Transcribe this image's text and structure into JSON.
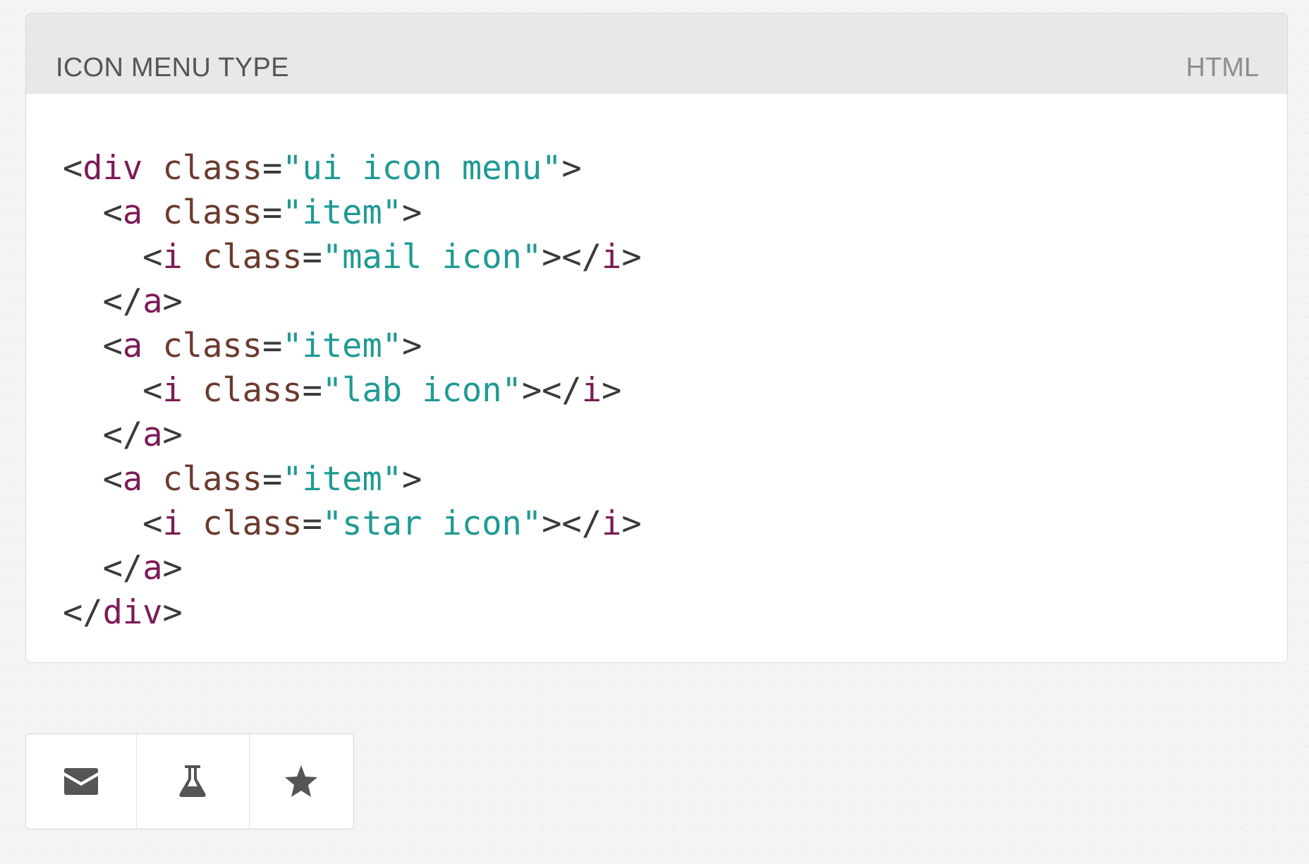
{
  "panel": {
    "title": "ICON MENU TYPE",
    "language": "HTML"
  },
  "code": {
    "lines": [
      [
        {
          "t": "punct",
          "v": "<"
        },
        {
          "t": "tag",
          "v": "div"
        },
        {
          "t": "punct",
          "v": " "
        },
        {
          "t": "attr",
          "v": "class"
        },
        {
          "t": "punct",
          "v": "="
        },
        {
          "t": "val",
          "v": "\"ui icon menu\""
        },
        {
          "t": "punct",
          "v": ">"
        }
      ],
      [
        {
          "t": "punct",
          "v": "  <"
        },
        {
          "t": "tag",
          "v": "a"
        },
        {
          "t": "punct",
          "v": " "
        },
        {
          "t": "attr",
          "v": "class"
        },
        {
          "t": "punct",
          "v": "="
        },
        {
          "t": "val",
          "v": "\"item\""
        },
        {
          "t": "punct",
          "v": ">"
        }
      ],
      [
        {
          "t": "punct",
          "v": "    <"
        },
        {
          "t": "tag",
          "v": "i"
        },
        {
          "t": "punct",
          "v": " "
        },
        {
          "t": "attr",
          "v": "class"
        },
        {
          "t": "punct",
          "v": "="
        },
        {
          "t": "val",
          "v": "\"mail icon\""
        },
        {
          "t": "punct",
          "v": "></"
        },
        {
          "t": "tag",
          "v": "i"
        },
        {
          "t": "punct",
          "v": ">"
        }
      ],
      [
        {
          "t": "punct",
          "v": "  </"
        },
        {
          "t": "tag",
          "v": "a"
        },
        {
          "t": "punct",
          "v": ">"
        }
      ],
      [
        {
          "t": "punct",
          "v": "  <"
        },
        {
          "t": "tag",
          "v": "a"
        },
        {
          "t": "punct",
          "v": " "
        },
        {
          "t": "attr",
          "v": "class"
        },
        {
          "t": "punct",
          "v": "="
        },
        {
          "t": "val",
          "v": "\"item\""
        },
        {
          "t": "punct",
          "v": ">"
        }
      ],
      [
        {
          "t": "punct",
          "v": "    <"
        },
        {
          "t": "tag",
          "v": "i"
        },
        {
          "t": "punct",
          "v": " "
        },
        {
          "t": "attr",
          "v": "class"
        },
        {
          "t": "punct",
          "v": "="
        },
        {
          "t": "val",
          "v": "\"lab icon\""
        },
        {
          "t": "punct",
          "v": "></"
        },
        {
          "t": "tag",
          "v": "i"
        },
        {
          "t": "punct",
          "v": ">"
        }
      ],
      [
        {
          "t": "punct",
          "v": "  </"
        },
        {
          "t": "tag",
          "v": "a"
        },
        {
          "t": "punct",
          "v": ">"
        }
      ],
      [
        {
          "t": "punct",
          "v": "  <"
        },
        {
          "t": "tag",
          "v": "a"
        },
        {
          "t": "punct",
          "v": " "
        },
        {
          "t": "attr",
          "v": "class"
        },
        {
          "t": "punct",
          "v": "="
        },
        {
          "t": "val",
          "v": "\"item\""
        },
        {
          "t": "punct",
          "v": ">"
        }
      ],
      [
        {
          "t": "punct",
          "v": "    <"
        },
        {
          "t": "tag",
          "v": "i"
        },
        {
          "t": "punct",
          "v": " "
        },
        {
          "t": "attr",
          "v": "class"
        },
        {
          "t": "punct",
          "v": "="
        },
        {
          "t": "val",
          "v": "\"star icon\""
        },
        {
          "t": "punct",
          "v": "></"
        },
        {
          "t": "tag",
          "v": "i"
        },
        {
          "t": "punct",
          "v": ">"
        }
      ],
      [
        {
          "t": "punct",
          "v": "  </"
        },
        {
          "t": "tag",
          "v": "a"
        },
        {
          "t": "punct",
          "v": ">"
        }
      ],
      [
        {
          "t": "punct",
          "v": "</"
        },
        {
          "t": "tag",
          "v": "div"
        },
        {
          "t": "punct",
          "v": ">"
        }
      ]
    ]
  },
  "icon_menu": {
    "items": [
      {
        "icon": "mail-icon"
      },
      {
        "icon": "lab-icon"
      },
      {
        "icon": "star-icon"
      }
    ],
    "icon_color": "#555555"
  },
  "colors": {
    "tag": "#7c1b56",
    "attribute": "#6b3a2e",
    "string": "#1f9a94",
    "punctuation": "#3a3a3a",
    "header_bg": "#e8e8e8"
  }
}
